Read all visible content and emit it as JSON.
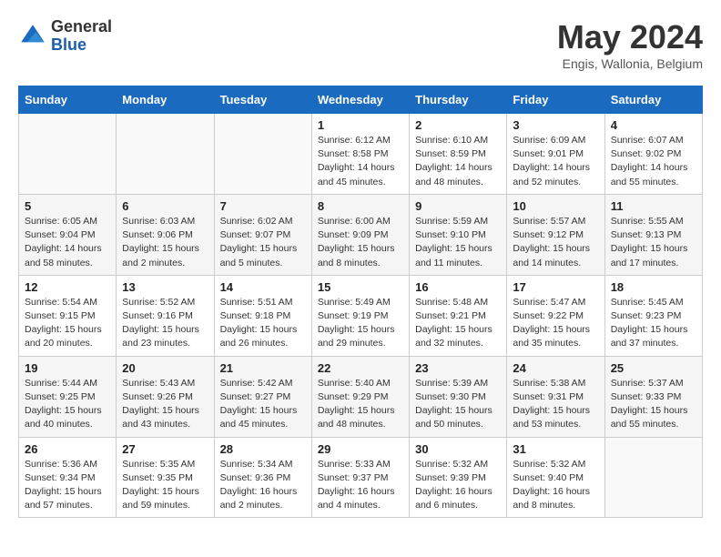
{
  "logo": {
    "general": "General",
    "blue": "Blue"
  },
  "title": "May 2024",
  "subtitle": "Engis, Wallonia, Belgium",
  "headers": [
    "Sunday",
    "Monday",
    "Tuesday",
    "Wednesday",
    "Thursday",
    "Friday",
    "Saturday"
  ],
  "weeks": [
    [
      {
        "day": "",
        "info": ""
      },
      {
        "day": "",
        "info": ""
      },
      {
        "day": "",
        "info": ""
      },
      {
        "day": "1",
        "info": "Sunrise: 6:12 AM\nSunset: 8:58 PM\nDaylight: 14 hours\nand 45 minutes."
      },
      {
        "day": "2",
        "info": "Sunrise: 6:10 AM\nSunset: 8:59 PM\nDaylight: 14 hours\nand 48 minutes."
      },
      {
        "day": "3",
        "info": "Sunrise: 6:09 AM\nSunset: 9:01 PM\nDaylight: 14 hours\nand 52 minutes."
      },
      {
        "day": "4",
        "info": "Sunrise: 6:07 AM\nSunset: 9:02 PM\nDaylight: 14 hours\nand 55 minutes."
      }
    ],
    [
      {
        "day": "5",
        "info": "Sunrise: 6:05 AM\nSunset: 9:04 PM\nDaylight: 14 hours\nand 58 minutes."
      },
      {
        "day": "6",
        "info": "Sunrise: 6:03 AM\nSunset: 9:06 PM\nDaylight: 15 hours\nand 2 minutes."
      },
      {
        "day": "7",
        "info": "Sunrise: 6:02 AM\nSunset: 9:07 PM\nDaylight: 15 hours\nand 5 minutes."
      },
      {
        "day": "8",
        "info": "Sunrise: 6:00 AM\nSunset: 9:09 PM\nDaylight: 15 hours\nand 8 minutes."
      },
      {
        "day": "9",
        "info": "Sunrise: 5:59 AM\nSunset: 9:10 PM\nDaylight: 15 hours\nand 11 minutes."
      },
      {
        "day": "10",
        "info": "Sunrise: 5:57 AM\nSunset: 9:12 PM\nDaylight: 15 hours\nand 14 minutes."
      },
      {
        "day": "11",
        "info": "Sunrise: 5:55 AM\nSunset: 9:13 PM\nDaylight: 15 hours\nand 17 minutes."
      }
    ],
    [
      {
        "day": "12",
        "info": "Sunrise: 5:54 AM\nSunset: 9:15 PM\nDaylight: 15 hours\nand 20 minutes."
      },
      {
        "day": "13",
        "info": "Sunrise: 5:52 AM\nSunset: 9:16 PM\nDaylight: 15 hours\nand 23 minutes."
      },
      {
        "day": "14",
        "info": "Sunrise: 5:51 AM\nSunset: 9:18 PM\nDaylight: 15 hours\nand 26 minutes."
      },
      {
        "day": "15",
        "info": "Sunrise: 5:49 AM\nSunset: 9:19 PM\nDaylight: 15 hours\nand 29 minutes."
      },
      {
        "day": "16",
        "info": "Sunrise: 5:48 AM\nSunset: 9:21 PM\nDaylight: 15 hours\nand 32 minutes."
      },
      {
        "day": "17",
        "info": "Sunrise: 5:47 AM\nSunset: 9:22 PM\nDaylight: 15 hours\nand 35 minutes."
      },
      {
        "day": "18",
        "info": "Sunrise: 5:45 AM\nSunset: 9:23 PM\nDaylight: 15 hours\nand 37 minutes."
      }
    ],
    [
      {
        "day": "19",
        "info": "Sunrise: 5:44 AM\nSunset: 9:25 PM\nDaylight: 15 hours\nand 40 minutes."
      },
      {
        "day": "20",
        "info": "Sunrise: 5:43 AM\nSunset: 9:26 PM\nDaylight: 15 hours\nand 43 minutes."
      },
      {
        "day": "21",
        "info": "Sunrise: 5:42 AM\nSunset: 9:27 PM\nDaylight: 15 hours\nand 45 minutes."
      },
      {
        "day": "22",
        "info": "Sunrise: 5:40 AM\nSunset: 9:29 PM\nDaylight: 15 hours\nand 48 minutes."
      },
      {
        "day": "23",
        "info": "Sunrise: 5:39 AM\nSunset: 9:30 PM\nDaylight: 15 hours\nand 50 minutes."
      },
      {
        "day": "24",
        "info": "Sunrise: 5:38 AM\nSunset: 9:31 PM\nDaylight: 15 hours\nand 53 minutes."
      },
      {
        "day": "25",
        "info": "Sunrise: 5:37 AM\nSunset: 9:33 PM\nDaylight: 15 hours\nand 55 minutes."
      }
    ],
    [
      {
        "day": "26",
        "info": "Sunrise: 5:36 AM\nSunset: 9:34 PM\nDaylight: 15 hours\nand 57 minutes."
      },
      {
        "day": "27",
        "info": "Sunrise: 5:35 AM\nSunset: 9:35 PM\nDaylight: 15 hours\nand 59 minutes."
      },
      {
        "day": "28",
        "info": "Sunrise: 5:34 AM\nSunset: 9:36 PM\nDaylight: 16 hours\nand 2 minutes."
      },
      {
        "day": "29",
        "info": "Sunrise: 5:33 AM\nSunset: 9:37 PM\nDaylight: 16 hours\nand 4 minutes."
      },
      {
        "day": "30",
        "info": "Sunrise: 5:32 AM\nSunset: 9:39 PM\nDaylight: 16 hours\nand 6 minutes."
      },
      {
        "day": "31",
        "info": "Sunrise: 5:32 AM\nSunset: 9:40 PM\nDaylight: 16 hours\nand 8 minutes."
      },
      {
        "day": "",
        "info": ""
      }
    ]
  ]
}
